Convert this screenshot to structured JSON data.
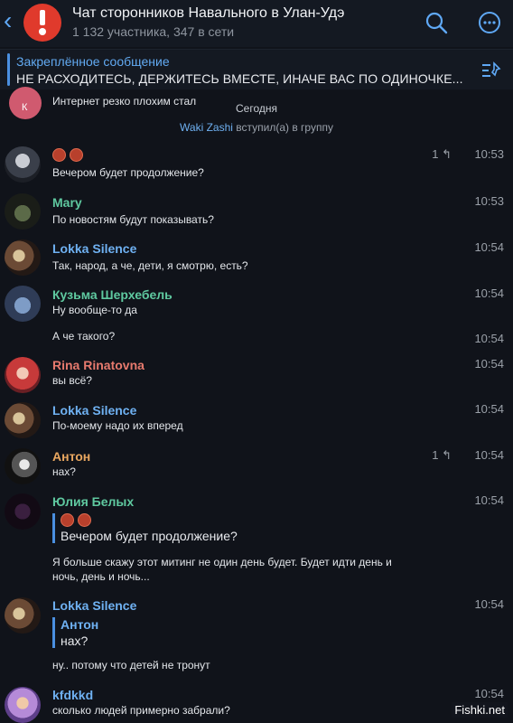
{
  "header": {
    "title": "Чат сторонников Навального в Улан-Удэ",
    "subtitle": "1 132 участника, 347 в сети",
    "avatar_icon": "exclamation-icon"
  },
  "pinned": {
    "label": "Закреплённое сообщение",
    "text": "НЕ РАСХОДИТЕСЬ, ДЕРЖИТЕСЬ ВМЕСТЕ, ИНАЧЕ ВАС ПО ОДИНОЧКЕ..."
  },
  "partial_message": {
    "avatar_letter": "К",
    "text": "Интернет резко плохим стал"
  },
  "date_separator": "Сегодня",
  "service_message": {
    "user": "Waki Zashi",
    "action": " вступил(а) в группу"
  },
  "messages": [
    {
      "name": "",
      "text": "Вечером будет продолжение?",
      "time": "10:53",
      "replies": "1"
    },
    {
      "name": "Mary",
      "text": "По новостям будут показывать?",
      "time": "10:53"
    },
    {
      "name": "Lokka Silence",
      "text": "Так, народ, а че, дети, я смотрю, есть?",
      "time": "10:54"
    },
    {
      "name": "Кузьма Шерхебель",
      "text": "Ну вообще-то да",
      "time": "10:54",
      "extra_text": "А че такого?",
      "extra_time": "10:54"
    },
    {
      "name": "Rina Rinatovna",
      "text": "вы всё?",
      "time": "10:54"
    },
    {
      "name": "Lokka Silence",
      "text": "По-моему надо их вперед",
      "time": "10:54"
    },
    {
      "name": "Антон",
      "text": "нах?",
      "time": "10:54",
      "replies": "1"
    },
    {
      "name": "Юлия Белых",
      "time": "10:54",
      "quote_text": "Вечером будет продолжение?",
      "text_line1": "Я больше скажу этот митинг не один день будет. Будет идти день и",
      "text_line2": "ночь, день и ночь..."
    },
    {
      "name": "Lokka Silence",
      "time": "10:54",
      "quote_name": "Антон",
      "quote_text": "нах?",
      "text": "ну.. потому что детей не тронут"
    },
    {
      "name": "kfdkkd",
      "text": "сколько людей примерно забрали?",
      "time": "10:54"
    }
  ],
  "watermark": "Fishki.net",
  "colors": {
    "background": "#10131a",
    "header": "#141922",
    "accent": "#4a8fe0",
    "name_green": "#5fc9a0",
    "name_blue": "#6fb1f2",
    "name_red": "#e77a6e",
    "name_orange": "#e9a760"
  }
}
